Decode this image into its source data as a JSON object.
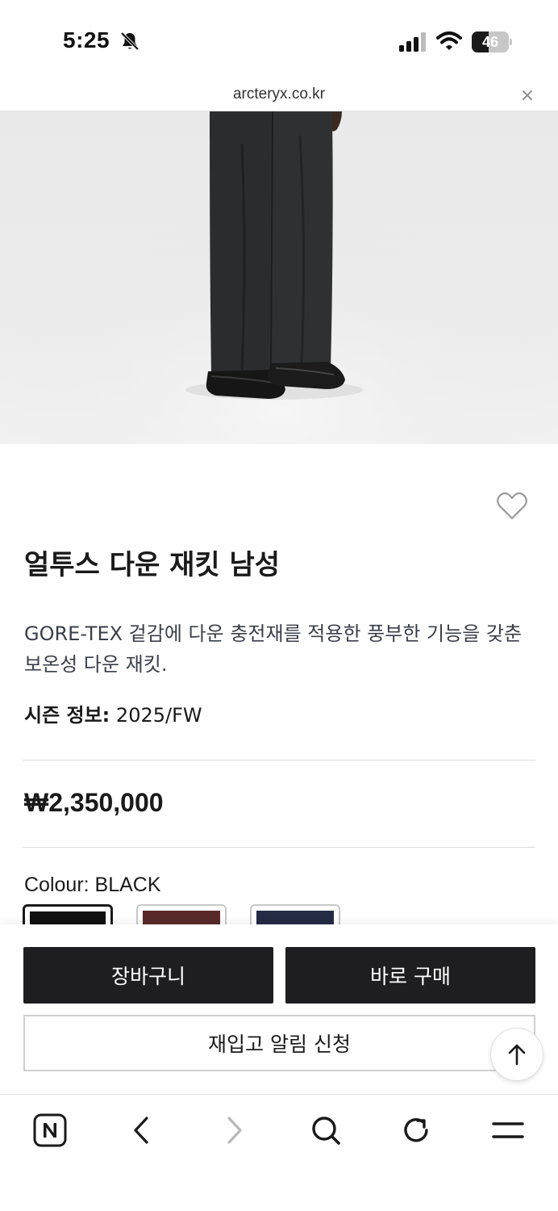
{
  "status_bar": {
    "time": "5:25",
    "battery_level": "46",
    "battery_fraction": 0.46
  },
  "url_bar": {
    "url": "arcteryx.co.kr",
    "close_symbol": "×"
  },
  "product": {
    "title": "얼투스 다운 재킷 남성",
    "description": "GORE-TEX 겉감에 다운 충전재를 적용한 풍부한 기능을 갖춘 보온성 다운 재킷.",
    "season_label": "시즌 정보:",
    "season_value": "2025/FW",
    "price": "₩2,350,000",
    "colour_label": "Colour:",
    "colour_value": "BLACK",
    "swatches": [
      {
        "color": "#111111",
        "selected": true
      },
      {
        "color": "#5a2a2a",
        "selected": false
      },
      {
        "color": "#262b45",
        "selected": false
      }
    ]
  },
  "actions": {
    "cart_label": "장바구니",
    "buy_label": "바로 구매",
    "restock_label": "재입고 알림 신청"
  },
  "icons": {
    "silent": "bell-slash-icon",
    "signal": "cellular-signal-icon",
    "wifi": "wifi-icon",
    "wishlist": "heart-outline-icon",
    "scroll_top": "arrow-up-icon",
    "naver": "naver-n-icon",
    "back": "chevron-left-icon",
    "forward": "chevron-right-icon",
    "search": "search-icon",
    "reload": "reload-icon",
    "menu": "menu-icon"
  },
  "colors": {
    "primary_button": "#1e1e20",
    "text": "#1a1a1a",
    "description_text": "#3a3f4a"
  }
}
